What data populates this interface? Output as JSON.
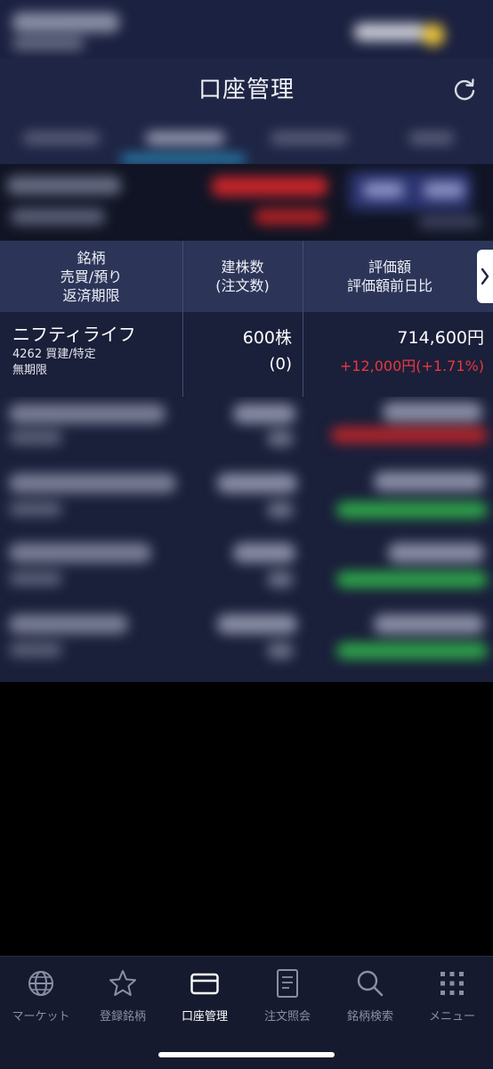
{
  "header": {
    "title": "口座管理"
  },
  "table": {
    "columns": [
      {
        "lines": [
          "銘柄",
          "売買/預り",
          "返済期限"
        ]
      },
      {
        "lines": [
          "建株数",
          "(注文数)"
        ]
      },
      {
        "lines": [
          "評価額",
          "評価額前日比"
        ]
      }
    ],
    "rows": [
      {
        "name": "ニフティライフ",
        "code_type": "4262 買建/特定",
        "deadline": "無期限",
        "quantity": "600株",
        "order_qty": "(0)",
        "value": "714,600円",
        "change": "+12,000円(+1.71%)"
      }
    ]
  },
  "colors": {
    "header_bg": "#1f2545",
    "row_bg": "#1a1f3a",
    "accent": "#2aa3d6",
    "up": "#e8393c",
    "down": "#2ea84a"
  },
  "nav": {
    "items": [
      {
        "label": "マーケット",
        "icon": "globe-icon"
      },
      {
        "label": "登録銘柄",
        "icon": "star-icon"
      },
      {
        "label": "口座管理",
        "icon": "card-icon",
        "active": true
      },
      {
        "label": "注文照会",
        "icon": "document-icon"
      },
      {
        "label": "銘柄検索",
        "icon": "search-icon"
      },
      {
        "label": "メニュー",
        "icon": "grid-icon"
      }
    ]
  }
}
